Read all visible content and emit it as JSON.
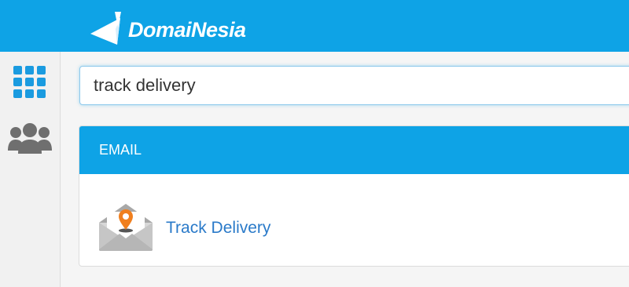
{
  "header": {
    "logo_text": "DomaiNesia",
    "brand_color": "#0ea3e6"
  },
  "sidebar": {
    "items": [
      {
        "icon": "apps-grid-icon"
      },
      {
        "icon": "users-icon"
      }
    ]
  },
  "search": {
    "value": "track delivery"
  },
  "results": {
    "section_title": "EMAIL",
    "items": [
      {
        "label": "Track Delivery",
        "icon": "track-delivery-icon"
      }
    ]
  },
  "colors": {
    "link": "#2a7ac9",
    "accent_orange": "#f07f1e"
  }
}
